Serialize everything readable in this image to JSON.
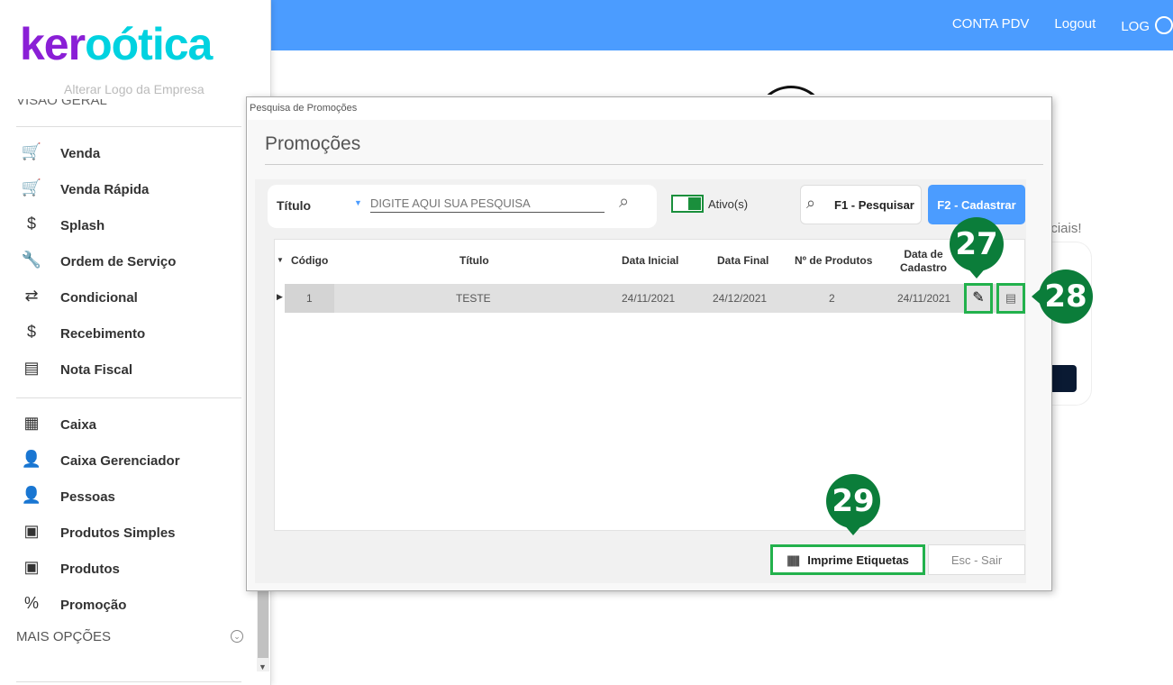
{
  "header": {
    "links": [
      "CONTA PDV",
      "Logout",
      "LOG"
    ]
  },
  "background": {
    "partial_text": "ociais!"
  },
  "sidebar": {
    "logo": {
      "part1": "ker",
      "part2": "oótica"
    },
    "alter_logo": "Alterar Logo da Empresa",
    "section": "VISÃO GERAL",
    "items": [
      {
        "label": "Venda",
        "icon": "cart-icon",
        "glyph": "🛒"
      },
      {
        "label": "Venda Rápida",
        "icon": "cart-fast-icon",
        "glyph": "🛒"
      },
      {
        "label": "Splash",
        "icon": "cart-dollar-icon",
        "glyph": "$"
      },
      {
        "label": "Ordem de Serviço",
        "icon": "tools-icon",
        "glyph": "🔧"
      },
      {
        "label": "Condicional",
        "icon": "cart-arrows-icon",
        "glyph": "⇄"
      },
      {
        "label": "Recebimento",
        "icon": "hand-money-icon",
        "glyph": "$"
      },
      {
        "label": "Nota Fiscal",
        "icon": "nfe-icon",
        "glyph": "▤"
      },
      {
        "label": "Caixa",
        "icon": "cash-register-icon",
        "glyph": "▦"
      },
      {
        "label": "Caixa Gerenciador",
        "icon": "user-money-icon",
        "glyph": "👤"
      },
      {
        "label": "Pessoas",
        "icon": "people-icon",
        "glyph": "👤"
      },
      {
        "label": "Produtos Simples",
        "icon": "box-icon",
        "glyph": "▣"
      },
      {
        "label": "Produtos",
        "icon": "box-icon",
        "glyph": "▣"
      },
      {
        "label": "Promoção",
        "icon": "tag-icon",
        "glyph": "%"
      }
    ],
    "more": "MAIS OPÇÕES"
  },
  "dialog": {
    "window_title": "Pesquisa de Promoções",
    "heading": "Promoções",
    "search": {
      "field": "Título",
      "placeholder": "DIGITE AQUI SUA PESQUISA"
    },
    "active_toggle": {
      "label": "Ativo(s)",
      "on": true
    },
    "btn_search": "F1 - Pesquisar",
    "btn_register": "F2 - Cadastrar",
    "columns": [
      "Código",
      "Título",
      "Data Inicial",
      "Data Final",
      "Nº de Produtos",
      "Data de Cadastro"
    ],
    "rows": [
      {
        "codigo": "1",
        "titulo": "TESTE",
        "inicial": "24/11/2021",
        "final": "24/12/2021",
        "produtos": "2",
        "cadastro": "24/11/2021"
      }
    ],
    "btn_print": "Imprime Etiquetas",
    "btn_exit": "Esc - Sair"
  },
  "callouts": [
    "27",
    "28",
    "29"
  ],
  "colors": {
    "header": "#4b9cff",
    "callout": "#0b7d3a",
    "highlight": "#22b14c"
  }
}
